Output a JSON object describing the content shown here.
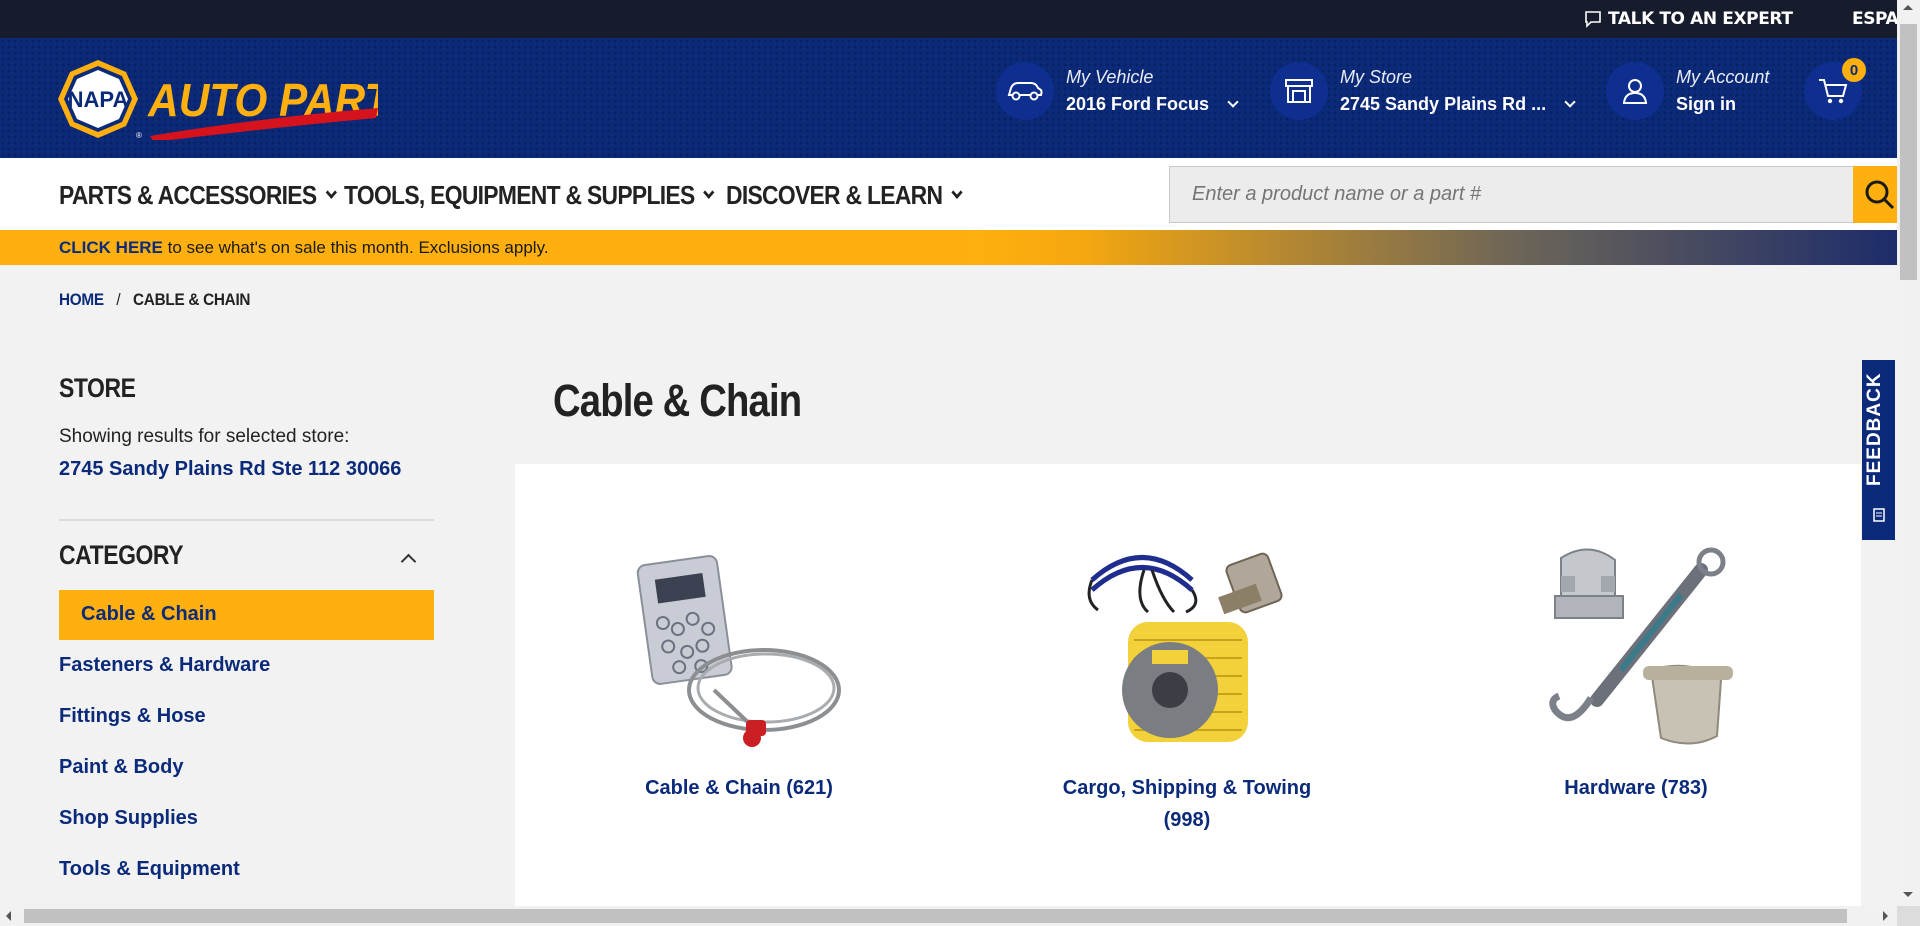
{
  "utility_bar": {
    "talk_expert": "TALK TO AN EXPERT",
    "language": "ESPAÑOL"
  },
  "brand": {
    "logo_badge": "NAPA",
    "logo_text": "AUTO PARTS",
    "colors": {
      "navy": "#0b2a7a",
      "gold": "#ffb00f",
      "red": "#d6121c"
    }
  },
  "header": {
    "vehicle": {
      "label": "My Vehicle",
      "value": "2016 Ford Focus"
    },
    "store": {
      "label": "My Store",
      "value": "2745 Sandy Plains Rd ..."
    },
    "account": {
      "label": "My Account",
      "value": "Sign in"
    },
    "cart_count": "0"
  },
  "nav": {
    "items": [
      "PARTS & ACCESSORIES",
      "TOOLS, EQUIPMENT & SUPPLIES",
      "DISCOVER & LEARN"
    ]
  },
  "search": {
    "placeholder": "Enter a product name or a part #"
  },
  "promo": {
    "cta": "CLICK HERE",
    "text": " to see what's on sale this month. Exclusions apply."
  },
  "breadcrumb": {
    "home": "HOME",
    "separator": "/",
    "current": "CABLE & CHAIN"
  },
  "sidebar": {
    "store_heading": "STORE",
    "store_note": "Showing results for selected store:",
    "store_address": "2745 Sandy Plains Rd Ste 112 30066",
    "category_heading": "CATEGORY",
    "categories": [
      "Cable & Chain",
      "Fasteners & Hardware",
      "Fittings & Hose",
      "Paint & Body",
      "Shop Supplies",
      "Tools & Equipment"
    ]
  },
  "main": {
    "title": "Cable & Chain",
    "cards": [
      {
        "name": "Cable & Chain (621)",
        "icon": "cable-chain-image"
      },
      {
        "name": "Cargo, Shipping & Towing (998)",
        "icon": "cargo-towing-image"
      },
      {
        "name": "Hardware (783)",
        "icon": "hardware-image"
      }
    ]
  },
  "feedback": {
    "label": "FEEDBACK"
  }
}
